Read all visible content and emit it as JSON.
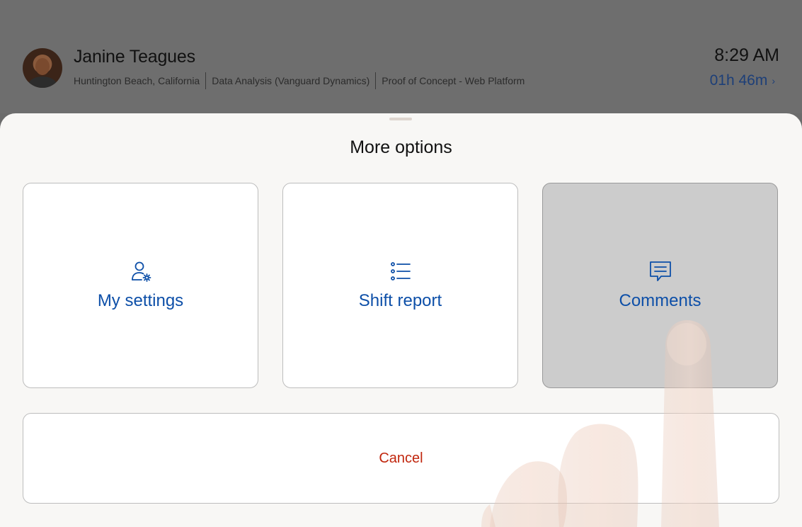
{
  "header": {
    "user_name": "Janine Teagues",
    "location": "Huntington Beach, California",
    "team": "Data Analysis (Vanguard Dynamics)",
    "project": "Proof of Concept - Web Platform",
    "time": "8:29 AM",
    "elapsed": "01h 46m",
    "elapsed_chevron": "›"
  },
  "sheet": {
    "title": "More options",
    "options": [
      {
        "label": "My settings",
        "icon": "user-settings-icon"
      },
      {
        "label": "Shift report",
        "icon": "list-icon"
      },
      {
        "label": "Comments",
        "icon": "comment-icon",
        "state": "pressed"
      }
    ],
    "cancel_label": "Cancel"
  },
  "colors": {
    "accent": "#0d4fa8",
    "cancel": "#c1260d",
    "elapsed": "#1d3f78",
    "sheet_bg": "#f8f7f5",
    "overlay_bg": "#6e6e6e",
    "pressed_bg": "#cccccc"
  }
}
